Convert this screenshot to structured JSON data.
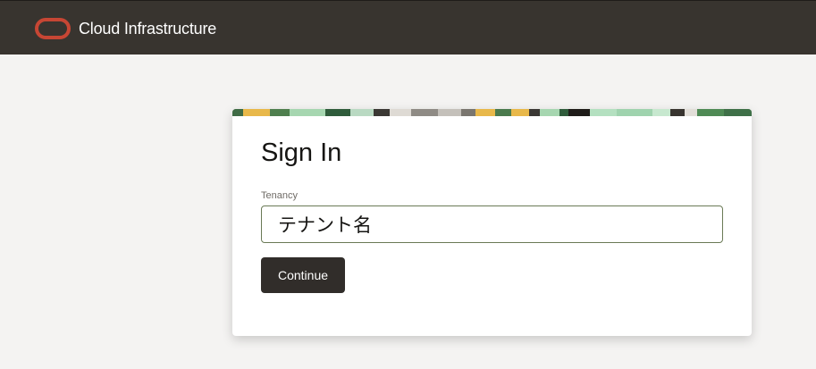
{
  "header": {
    "brand": "Cloud Infrastructure",
    "logo_icon": "oracle-logo-icon",
    "background": "#38342f",
    "logo_color": "#c74634"
  },
  "signin": {
    "title": "Sign In",
    "tenancy_label": "Tenancy",
    "tenancy_value": "テナント名",
    "continue_label": "Continue",
    "button_color": "#312d2a"
  }
}
